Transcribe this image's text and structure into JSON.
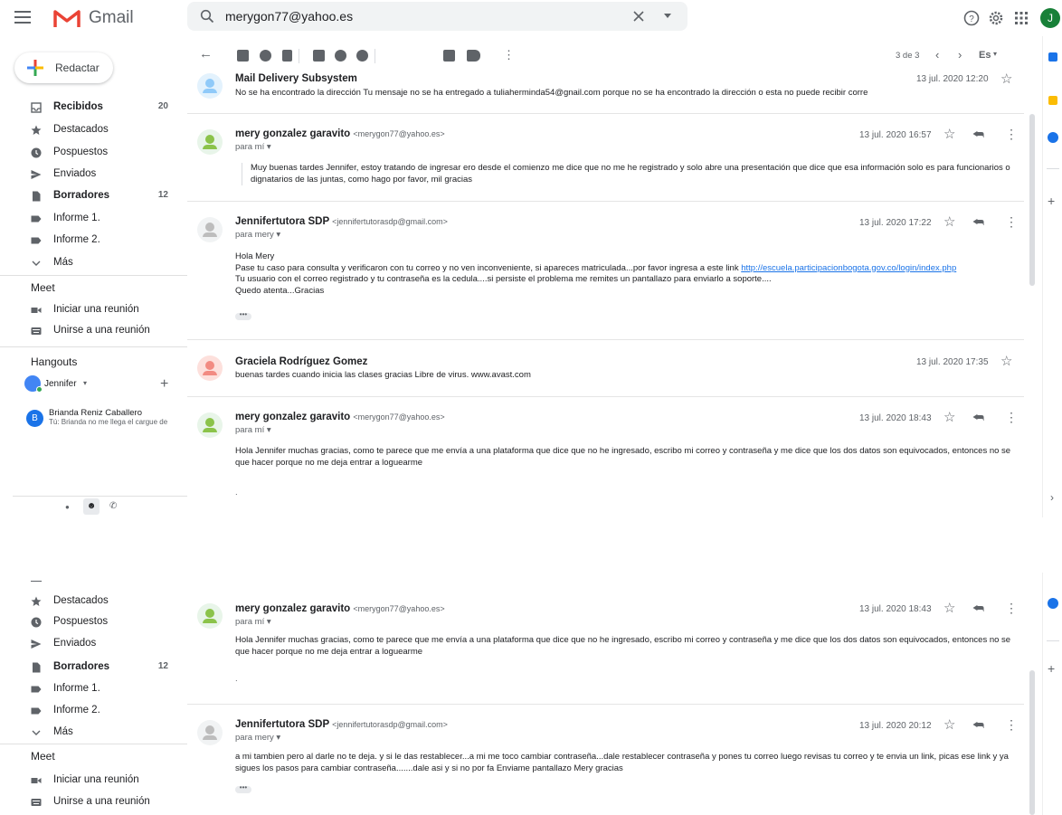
{
  "header": {
    "app_name": "Gmail",
    "search_value": "merygon77@yahoo.es",
    "avatar_initial": "J"
  },
  "compose_label": "Redactar",
  "sidebar": {
    "items": [
      {
        "label": "Recibidos",
        "count": "20",
        "bold": true
      },
      {
        "label": "Destacados",
        "count": ""
      },
      {
        "label": "Pospuestos",
        "count": ""
      },
      {
        "label": "Enviados",
        "count": ""
      },
      {
        "label": "Borradores",
        "count": "12",
        "bold": true
      },
      {
        "label": "Informe 1.",
        "count": ""
      },
      {
        "label": "Informe 2.",
        "count": ""
      },
      {
        "label": "Más",
        "count": ""
      }
    ],
    "meet_title": "Meet",
    "meet_items": [
      "Iniciar una reunión",
      "Unirse a una reunión"
    ],
    "hangouts_title": "Hangouts",
    "hangouts_user": "Jennifer",
    "chat_name": "Brianda Reniz Caballero",
    "chat_preview": "Tú: Brianda no me llega el cargue de",
    "chat_initial": "B"
  },
  "toolbar": {
    "pagination": "3 de 3",
    "lang": "Es"
  },
  "messages": [
    {
      "sender": "Mail Delivery Subsystem",
      "date": "13 jul. 2020 12:20",
      "snippet": "No se ha encontrado la dirección Tu mensaje no se ha entregado a tuliaherminda54@gnail.com porque no se ha encontrado la dirección o esta no puede recibir corre"
    },
    {
      "sender": "mery gonzalez garavito",
      "email": "<merygon77@yahoo.es>",
      "to": "para mí",
      "date": "13 jul. 2020 16:57",
      "body": "Muy buenas tardes Jennifer, estoy tratando de ingresar ero desde el comienzo me dice que no me he registrado y solo abre una presentación que dice que esa información solo es para funcionarios o  dignatarios de las juntas, como hago por favor, mil gracias"
    },
    {
      "sender": "Jennifertutora SDP",
      "email": "<jennifertutorasdp@gmail.com>",
      "to": "para mery",
      "date": "13 jul. 2020 17:22",
      "line1": "Hola Mery",
      "line2": "Pase tu caso para consulta y verificaron con tu correo y no ven inconveniente, si apareces matriculada...por favor ingresa a este link ",
      "link": "http://escuela.participacionbogota.gov.co/login/index.php",
      "line3": "Tu usuario con el correo registrado y tu contraseña es la cedula....si persiste el problema me remites un pantallazo para enviarlo a soporte....",
      "line4": "Quedo atenta...Gracias"
    },
    {
      "sender": "Graciela Rodríguez Gomez",
      "date": "13 jul. 2020 17:35",
      "snippet": "buenas tardes cuando inicia las clases gracias Libre de virus. www.avast.com"
    },
    {
      "sender": "mery gonzalez garavito",
      "email": "<merygon77@yahoo.es>",
      "to": "para mí",
      "date": "13 jul. 2020 18:43",
      "body": "Hola Jennifer muchas gracias, como te parece que me envía a una plataforma que dice que no he ingresado, escribo mi correo y contraseña y me dice que los dos datos son equivocados, entonces no se que hacer porque no me deja entrar a loguearme",
      "trail": "."
    },
    {
      "sender": "Jennifertutora SDP",
      "email": "<jennifertutorasdp@gmail.com>",
      "to": "para mery",
      "date": "13 jul. 2020 20:12",
      "body": "a mi tambien pero al darle no te deja. y si le das restablecer...a mi me toco cambiar contraseña...dale restablecer contraseña y pones tu correo luego revisas tu correo y te envia un link, picas ese link y ya sigues los pasos para cambiar contraseña.......dale asi y si no por fa Enviame pantallazo Mery gracias"
    }
  ],
  "ellipsis": "•••",
  "colors": {
    "accent": "#1a73e8",
    "avatar_green": "#188038"
  }
}
